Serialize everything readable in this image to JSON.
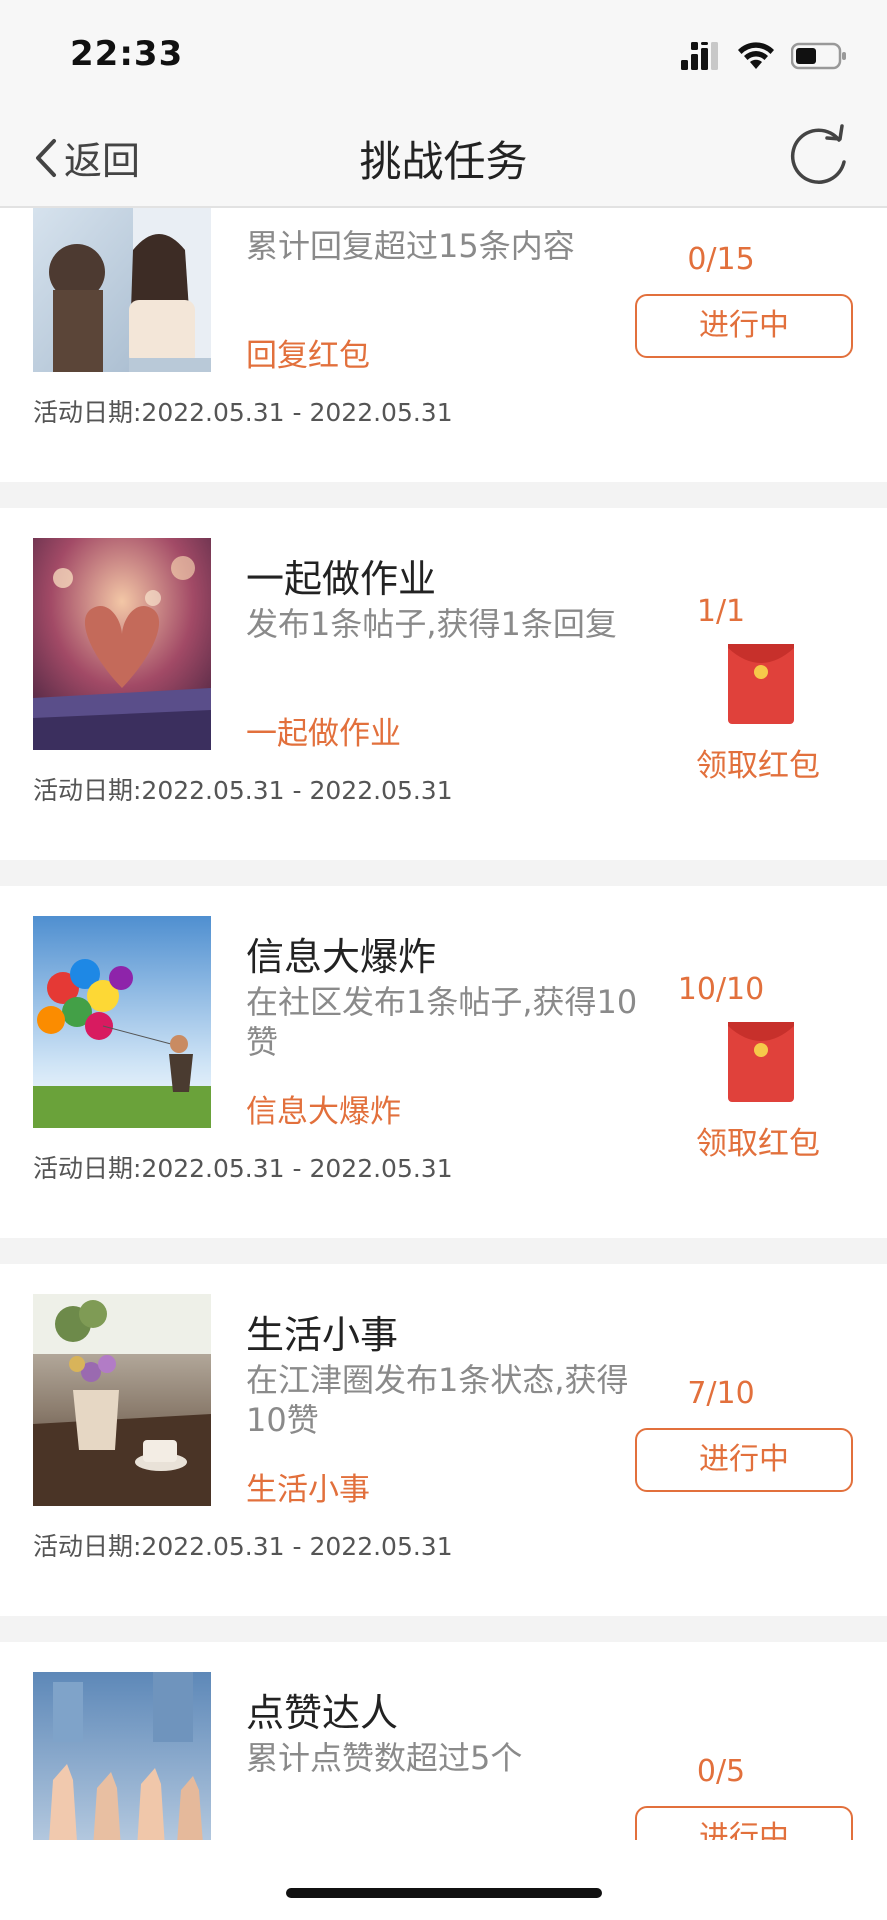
{
  "status_bar": {
    "time": "22:33"
  },
  "nav": {
    "back_label": "返回",
    "title": "挑战任务"
  },
  "colors": {
    "accent": "#e2703c",
    "red_packet": "#e0413b"
  },
  "date_label": "活动日期:2022.05.31 - 2022.05.31",
  "tasks": [
    {
      "title": "",
      "desc": "累计回复超过15条内容",
      "tag": "回复红包",
      "date": "活动日期:2022.05.31 - 2022.05.31",
      "progress": "0/15",
      "status": "进行中",
      "image": "two-girls-window"
    },
    {
      "title": "一起做作业",
      "desc": "发布1条帖子,获得1条回复",
      "tag": "一起做作业",
      "date": "活动日期:2022.05.31 - 2022.05.31",
      "progress": "1/1",
      "status": "领取红包",
      "image": "book-heart"
    },
    {
      "title": "信息大爆炸",
      "desc": "在社区发布1条帖子,获得10赞",
      "tag": "信息大爆炸",
      "date": "活动日期:2022.05.31 - 2022.05.31",
      "progress": "10/10",
      "status": "领取红包",
      "image": "balloons-child"
    },
    {
      "title": "生活小事",
      "desc": "在江津圈发布1条状态,获得10赞",
      "tag": "生活小事",
      "date": "活动日期:2022.05.31 - 2022.05.31",
      "progress": "7/10",
      "status": "进行中",
      "image": "flowers-coffee"
    },
    {
      "title": "点赞达人",
      "desc": "累计点赞数超过5个",
      "tag": "",
      "date": "",
      "progress": "0/5",
      "status": "进行中",
      "image": "thumbs-up"
    }
  ]
}
